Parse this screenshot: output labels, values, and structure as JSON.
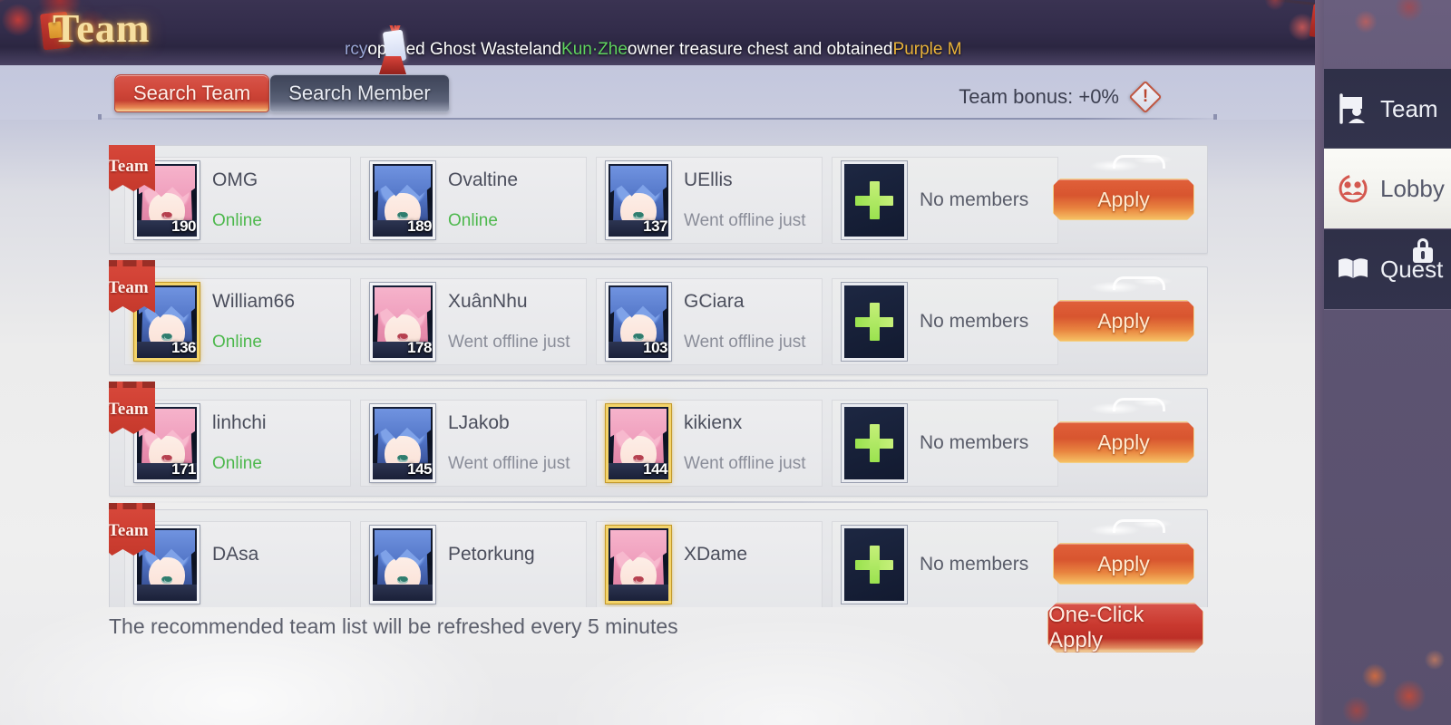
{
  "window": {
    "title": "Team",
    "close_label": "close-button"
  },
  "announcement": {
    "prefix": "rcy",
    "text1": " opened Ghost Wasteland ",
    "highlight_green": "Kun·Zhe",
    "text2": " owner treasure chest and obtained ",
    "highlight_gold": "Purple M"
  },
  "tabs": [
    {
      "label": "Search Team",
      "active": true
    },
    {
      "label": "Search Member",
      "active": false
    }
  ],
  "bonus": {
    "label": "Team bonus: +0%",
    "info_icon": "warning-icon"
  },
  "list": {
    "flag_label": "Team",
    "empty_label": "No members",
    "apply_label": "Apply",
    "rows": [
      {
        "members": [
          {
            "name": "OMG",
            "level": "190",
            "status": "Online",
            "online": true,
            "hair": "pink",
            "gold": false
          },
          {
            "name": "Ovaltine",
            "level": "189",
            "status": "Online",
            "online": true,
            "hair": "blue",
            "gold": false
          },
          {
            "name": "UEllis",
            "level": "137",
            "status": "Went offline just",
            "online": false,
            "hair": "blue",
            "gold": false
          }
        ]
      },
      {
        "members": [
          {
            "name": "William66",
            "level": "136",
            "status": "Online",
            "online": true,
            "hair": "blue",
            "gold": true
          },
          {
            "name": "XuânNhu",
            "level": "178",
            "status": "Went offline just",
            "online": false,
            "hair": "pink",
            "gold": false
          },
          {
            "name": "GCiara",
            "level": "103",
            "status": "Went offline just",
            "online": false,
            "hair": "blue",
            "gold": false
          }
        ]
      },
      {
        "members": [
          {
            "name": "linhchi",
            "level": "171",
            "status": "Online",
            "online": true,
            "hair": "pink",
            "gold": false
          },
          {
            "name": "LJakob",
            "level": "145",
            "status": "Went offline just",
            "online": false,
            "hair": "blue",
            "gold": false
          },
          {
            "name": "kikienx",
            "level": "144",
            "status": "Went offline just",
            "online": false,
            "hair": "pink",
            "gold": true
          }
        ]
      },
      {
        "members": [
          {
            "name": "DAsa",
            "level": "",
            "status": "",
            "online": false,
            "hair": "blue",
            "gold": false
          },
          {
            "name": "Petorkung",
            "level": "",
            "status": "",
            "online": false,
            "hair": "blue",
            "gold": false
          },
          {
            "name": "XDame",
            "level": "",
            "status": "",
            "online": false,
            "hair": "pink",
            "gold": true
          }
        ]
      }
    ]
  },
  "footer": {
    "note": "The recommended team list will be refreshed every 5 minutes",
    "one_click_label": "One-Click Apply"
  },
  "sidebar": {
    "items": [
      {
        "label": "Team",
        "icon": "flag-team-icon",
        "active": false,
        "locked": false
      },
      {
        "label": "Lobby",
        "icon": "group-lobby-icon",
        "active": true,
        "locked": false
      },
      {
        "label": "Quest",
        "icon": "book-quest-icon",
        "active": false,
        "locked": true
      }
    ]
  },
  "colors": {
    "accent_red": "#cf4639",
    "accent_orange": "#e8833f",
    "online_green": "#4db84d",
    "gold": "#f6dfa0",
    "sidebar_dark": "#2f3048"
  }
}
